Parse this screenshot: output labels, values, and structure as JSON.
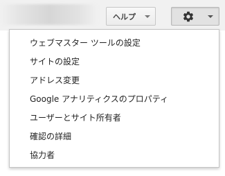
{
  "header": {
    "help_label": "ヘルプ",
    "settings_icon": "gear-icon"
  },
  "settings_menu": {
    "items": [
      {
        "label": "ウェブマスター ツールの設定"
      },
      {
        "label": "サイトの設定"
      },
      {
        "label": "アドレス変更"
      },
      {
        "label": "Google アナリティクスのプロパティ"
      },
      {
        "label": "ユーザーとサイト所有者"
      },
      {
        "label": "確認の詳細"
      },
      {
        "label": "協力者"
      }
    ]
  }
}
